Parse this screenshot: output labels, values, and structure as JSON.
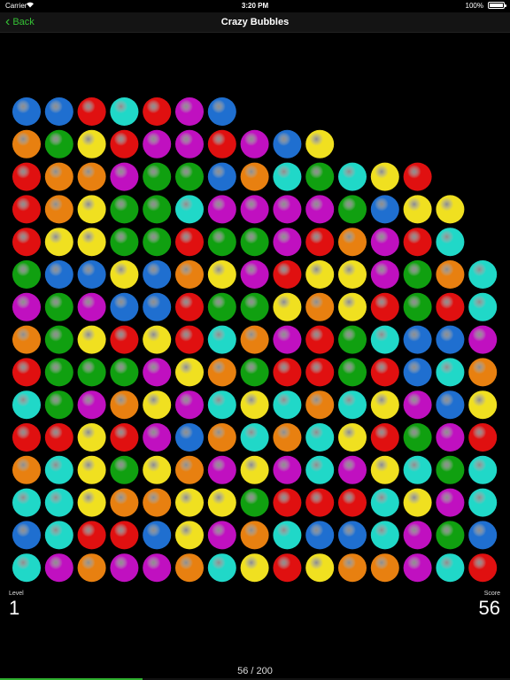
{
  "status_bar": {
    "carrier": "Carrier",
    "time": "3:20 PM",
    "battery": "100%"
  },
  "nav": {
    "back_label": "Back",
    "title": "Crazy Bubbles"
  },
  "colors": {
    "B": "#1f6fd0",
    "R": "#e01010",
    "C": "#20d8c8",
    "M": "#c010c0",
    "O": "#e88010",
    "G": "#10a010",
    "Y": "#f0e020",
    "accent": "#35c135"
  },
  "board": {
    "rows": [
      "BBRCRMB",
      "OGYRMMRMBY",
      "ROOMGGBOCGCYR",
      "ROYGGCMMMMGBYY",
      "RYYGGRGGMROMRC",
      "GBBYBOYMRYYMGOC",
      "MGMBBRGGYOYRGRC",
      "OGYRYRCOMRGCBBM",
      "RGGGMYOGRRGRBCO",
      "CGMOYMCYCOCYMBY",
      "RRYRMBOCOCYRGMR",
      "OCYGYOMYMCMYCGC",
      "CCYOOYYGRRRCYMC",
      "BCRRBYMOCBBCMGB",
      "CMOMMOCYRYOOMCR"
    ]
  },
  "hud": {
    "level_label": "Level",
    "level": "1",
    "score_label": "Score",
    "score": "56",
    "progress_text": "56 / 200",
    "progress_current": 56,
    "progress_total": 200
  }
}
